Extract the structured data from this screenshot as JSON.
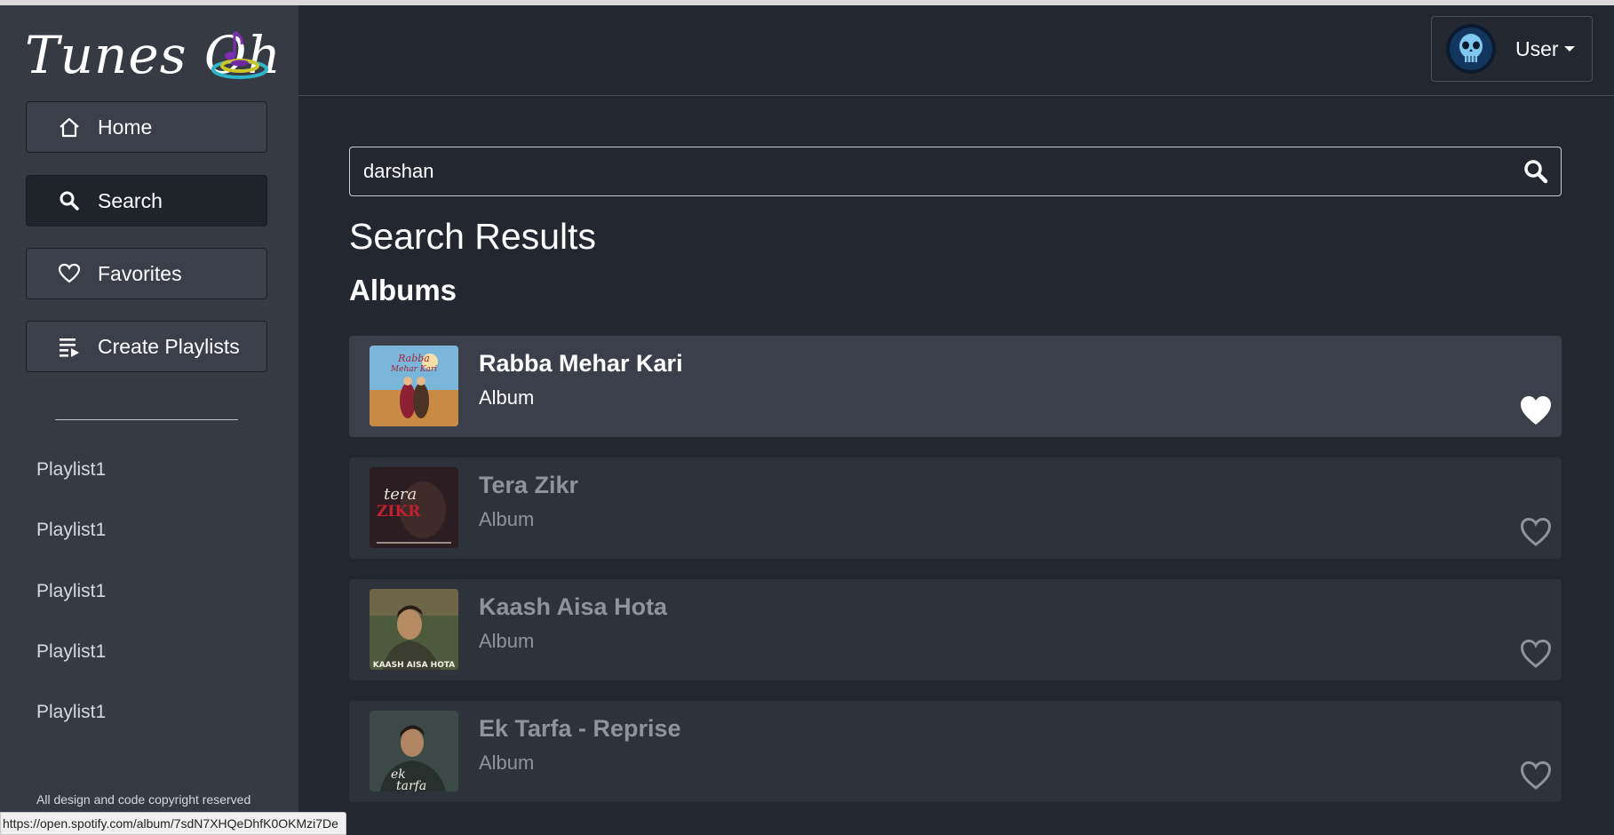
{
  "app": {
    "brand_name": "Tunes Oh"
  },
  "sidebar": {
    "nav": [
      {
        "label": "Home",
        "icon": "home-icon"
      },
      {
        "label": "Search",
        "icon": "search-icon"
      },
      {
        "label": "Favorites",
        "icon": "heart-icon"
      },
      {
        "label": "Create Playlists",
        "icon": "playlist-add-icon"
      }
    ],
    "active_nav": "Search",
    "playlists": [
      "Playlist1",
      "Playlist1",
      "Playlist1",
      "Playlist1",
      "Playlist1"
    ],
    "copyright": "All design and code copyright reserved"
  },
  "header": {
    "user_label": "User"
  },
  "search": {
    "value": "darshan"
  },
  "results": {
    "title": "Search Results",
    "section_title": "Albums",
    "albums": [
      {
        "name": "Rabba Mehar Kari",
        "type": "Album",
        "favorited": true
      },
      {
        "name": "Tera Zikr",
        "type": "Album",
        "favorited": false
      },
      {
        "name": "Kaash Aisa Hota",
        "type": "Album",
        "favorited": false
      },
      {
        "name": "Ek Tarfa - Reprise",
        "type": "Album",
        "favorited": false
      }
    ]
  },
  "status_bar": {
    "url": "https://open.spotify.com/album/7sdN7XHQeDhfK0OKMzi7De"
  },
  "colors": {
    "sidebar_bg": "#363a43",
    "main_bg": "#232830",
    "row_bg": "#2d323b",
    "row_highlight_bg": "#3a3f49",
    "muted_text": "#8f949b"
  }
}
